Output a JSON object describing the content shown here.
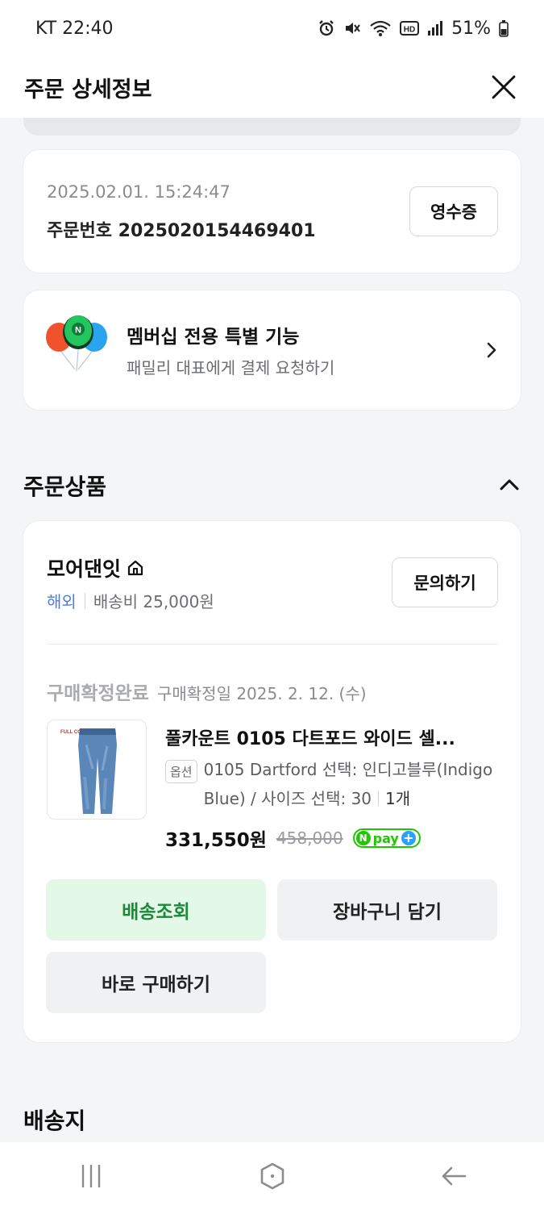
{
  "status_bar": {
    "carrier_time": "KT 22:40",
    "battery": "51%"
  },
  "header": {
    "title": "주문 상세정보"
  },
  "order": {
    "datetime": "2025.02.01. 15:24:47",
    "order_number_label": "주문번호",
    "order_number": "2025020154469401",
    "receipt_label": "영수증"
  },
  "membership": {
    "title": "멤버십 전용 특별 기능",
    "subtitle": "패밀리 대표에게 결제 요청하기"
  },
  "products_section": {
    "title": "주문상품"
  },
  "seller": {
    "name": "모어댄잇",
    "region": "해외",
    "shipping_fee": "배송비 25,000원",
    "inquiry_label": "문의하기"
  },
  "item": {
    "status": "구매확정완료",
    "confirm_date": "구매확정일 2025. 2. 12. (수)",
    "name": "풀카운트 0105 다트포드 와이드 셀...",
    "option_badge": "옵션",
    "option_text": "0105 Dartford 선택: 인디고블루(Indigo Blue) / 사이즈 선택: 30",
    "quantity": "1개",
    "price": "331,550원",
    "original_price": "458,000",
    "npay_label": "pay",
    "npay_n": "N",
    "npay_plus": "+",
    "thumb_brand": "FULL COUNT"
  },
  "actions": {
    "track": "배송조회",
    "cart": "장바구니 담기",
    "buy_now": "바로 구매하기"
  },
  "shipping_section": {
    "title": "배송지"
  },
  "colors": {
    "accent_green": "#1a8a3a",
    "track_bg": "#e4f8e8",
    "overseas_blue": "#4c7de0",
    "npay_green": "#1ec800"
  },
  "icons": {
    "close": "close-icon",
    "chevron_right": "chevron-right-icon",
    "chevron_up": "chevron-up-icon",
    "home": "home-icon",
    "recent_apps": "recent-apps-icon",
    "home_nav": "home-nav-icon",
    "back": "back-icon"
  }
}
